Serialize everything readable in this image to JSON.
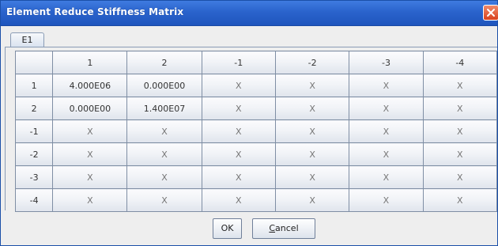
{
  "window": {
    "title": "Element Reduce Stiffness Matrix"
  },
  "tabs": [
    {
      "label": "E1"
    }
  ],
  "matrix": {
    "column_headers": [
      "",
      "1",
      "2",
      "-1",
      "-2",
      "-3",
      "-4"
    ],
    "rows": [
      {
        "label": "1",
        "cells": [
          "4.000E06",
          "0.000E00",
          "X",
          "X",
          "X",
          "X"
        ]
      },
      {
        "label": "2",
        "cells": [
          "0.000E00",
          "1.400E07",
          "X",
          "X",
          "X",
          "X"
        ]
      },
      {
        "label": "-1",
        "cells": [
          "X",
          "X",
          "X",
          "X",
          "X",
          "X"
        ]
      },
      {
        "label": "-2",
        "cells": [
          "X",
          "X",
          "X",
          "X",
          "X",
          "X"
        ]
      },
      {
        "label": "-3",
        "cells": [
          "X",
          "X",
          "X",
          "X",
          "X",
          "X"
        ]
      },
      {
        "label": "-4",
        "cells": [
          "X",
          "X",
          "X",
          "X",
          "X",
          "X"
        ]
      }
    ]
  },
  "buttons": {
    "ok_label": "OK",
    "cancel_label": "Cancel"
  },
  "icons": {
    "close": "close-icon"
  },
  "colors": {
    "titlebar": "#2a63cc",
    "close_button": "#d9421d",
    "dialog_background": "#eeeeee",
    "grid_border": "#7f8ea4"
  }
}
